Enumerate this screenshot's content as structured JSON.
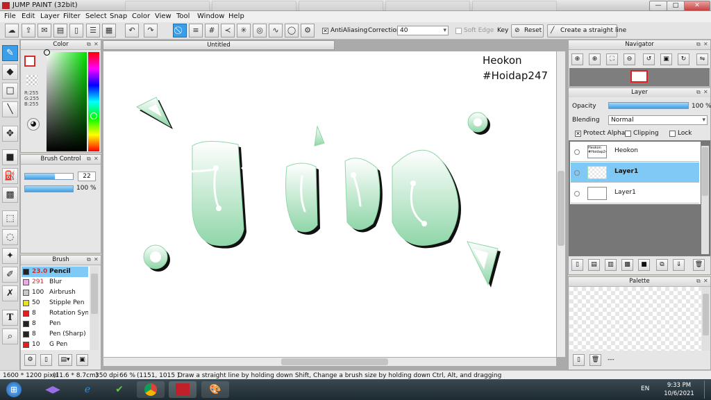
{
  "window": {
    "title": "JUMP PAINT (32bit)",
    "minimize": "—",
    "maximize": "□",
    "close": "✕"
  },
  "menu": [
    "File",
    "Edit",
    "Layer",
    "Filter",
    "Select",
    "Snap",
    "Color",
    "View",
    "Tool",
    "Window",
    "Help"
  ],
  "toolbar": {
    "antialiasing_label": "AntiAliasing",
    "antialiasing_checked": true,
    "correction_label": "Correction",
    "correction_value": "40",
    "soft_edge_label": "Soft Edge",
    "key_label": "Key",
    "reset_label": "Reset",
    "straight_line_label": "Create a straight line"
  },
  "color_panel": {
    "title": "Color",
    "r": "R:255",
    "g": "G:255",
    "b": "B:255",
    "foreground": "#ffffff",
    "accent": "#d42a2a"
  },
  "brush_control": {
    "title": "Brush Control",
    "size": "22",
    "opacity": "100 %",
    "size_fraction": 0.62,
    "opacity_fraction": 1.0
  },
  "brush_panel": {
    "title": "Brush",
    "items": [
      {
        "size": "23.0",
        "name": "Pencil",
        "color": "#222222",
        "selected": true
      },
      {
        "size": "291",
        "name": "Blur",
        "color": "#f2a6e6"
      },
      {
        "size": "100",
        "name": "Airbrush",
        "color": "#c8c8c8"
      },
      {
        "size": "50",
        "name": "Stipple Pen",
        "color": "#e8e020"
      },
      {
        "size": "8",
        "name": "Rotation Symmetry",
        "color": "#e02020"
      },
      {
        "size": "8",
        "name": "Pen",
        "color": "#222222"
      },
      {
        "size": "8",
        "name": "Pen (Sharp)",
        "color": "#222222"
      },
      {
        "size": "10",
        "name": "G Pen",
        "color": "#e02020"
      }
    ]
  },
  "document": {
    "tab_title": "Untitled",
    "watermark_line1": "Heokon",
    "watermark_line2": "#Hoidap247",
    "art_color": "#9fe0b4"
  },
  "navigator": {
    "title": "Navigator"
  },
  "layer_panel": {
    "title": "Layer",
    "opacity_label": "Opacity",
    "opacity_value": "100 %",
    "opacity_fraction": 1.0,
    "blending_label": "Blending",
    "blending_value": "Normal",
    "protect_alpha": "Protect Alpha",
    "clipping": "Clipping",
    "lock": "Lock",
    "layers": [
      {
        "name": "Heokon",
        "selected": false,
        "thumb": "Heokon #Hoidap247"
      },
      {
        "name": "Layer1",
        "selected": true,
        "thumb": ""
      },
      {
        "name": "Layer1",
        "selected": false,
        "thumb": ""
      }
    ]
  },
  "palette_panel": {
    "title": "Palette",
    "more": "---"
  },
  "status_bar": {
    "dims": "1600 * 1200 pixel",
    "size": "(11.6 * 8.7cm)",
    "dpi": "350 dpi",
    "zoom": "66 %",
    "coords": "(1151, 1015 )",
    "hint": "Draw a straight line by holding down Shift, Change a brush size by holding down Ctrl, Alt, and dragging"
  },
  "taskbar": {
    "lang": "EN",
    "time": "9:33 PM",
    "date": "10/6/2021"
  }
}
